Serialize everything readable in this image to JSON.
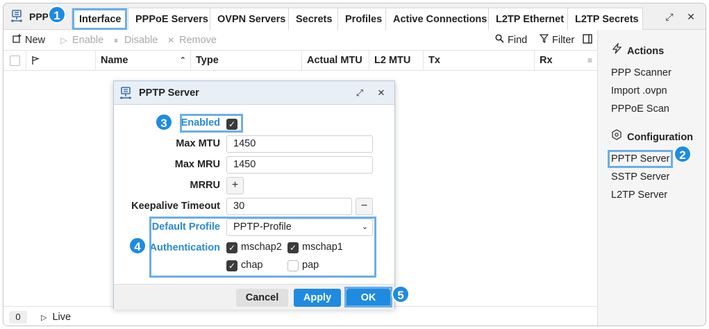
{
  "window": {
    "title": "PPP",
    "restore_glyph": "⤢",
    "close_glyph": "✕"
  },
  "tabs": [
    {
      "label": "Interface",
      "active": true
    },
    {
      "label": "PPPoE Servers"
    },
    {
      "label": "OVPN Servers"
    },
    {
      "label": "Secrets"
    },
    {
      "label": "Profiles"
    },
    {
      "label": "Active Connections"
    },
    {
      "label": "L2TP Ethernet"
    },
    {
      "label": "L2TP Secrets"
    }
  ],
  "toolbar": {
    "new": "New",
    "enable": "Enable",
    "disable": "Disable",
    "remove": "Remove",
    "find": "Find",
    "filter": "Filter"
  },
  "table": {
    "columns": [
      "Name",
      "Type",
      "Actual MTU",
      "L2 MTU",
      "Tx",
      "Rx"
    ],
    "rows": []
  },
  "statusbar": {
    "count": "0",
    "live": "Live"
  },
  "right_panel": {
    "actions_title": "Actions",
    "actions": [
      "PPP Scanner",
      "Import .ovpn",
      "PPPoE Scan"
    ],
    "config_title": "Configuration",
    "config": [
      "PPTP Server",
      "SSTP Server",
      "L2TP Server"
    ]
  },
  "dialog": {
    "title": "PPTP Server",
    "enabled_label": "Enabled",
    "enabled": true,
    "max_mtu_label": "Max MTU",
    "max_mtu": "1450",
    "max_mru_label": "Max MRU",
    "max_mru": "1450",
    "mrru_label": "MRRU",
    "keepalive_label": "Keepalive Timeout",
    "keepalive": "30",
    "default_profile_label": "Default Profile",
    "default_profile": "PPTP-Profile",
    "authentication_label": "Authentication",
    "auth": [
      {
        "label": "mschap2",
        "checked": true
      },
      {
        "label": "mschap1",
        "checked": true
      },
      {
        "label": "chap",
        "checked": true
      },
      {
        "label": "pap",
        "checked": false
      }
    ],
    "cancel": "Cancel",
    "apply": "Apply",
    "ok": "OK"
  },
  "badges": [
    "1",
    "2",
    "3",
    "4",
    "5"
  ],
  "colors": {
    "accent": "#1f8be0",
    "highlight": "#6aaee8"
  }
}
